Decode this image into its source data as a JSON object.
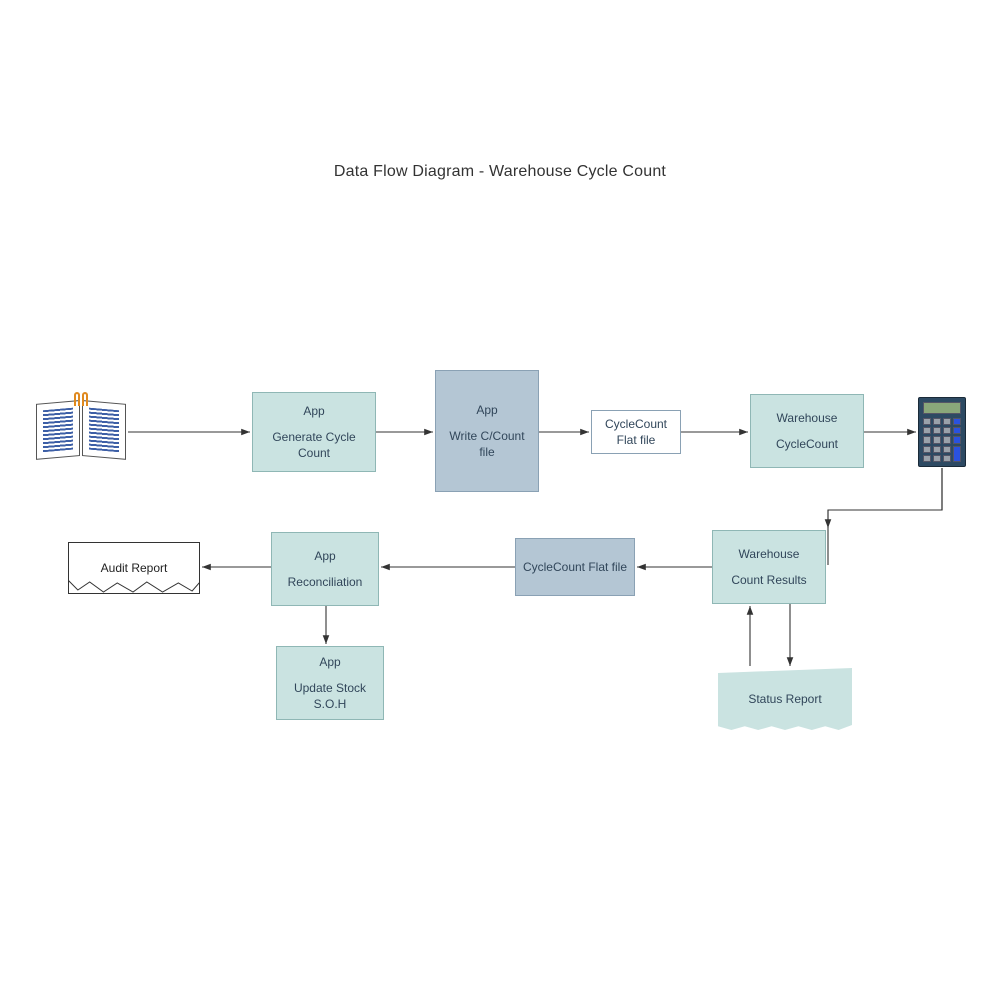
{
  "title": "Data Flow Diagram - Warehouse Cycle Count",
  "nodes": {
    "generateCycle": {
      "line1": "App",
      "line2": "Generate Cycle Count"
    },
    "writeCCount": {
      "line1": "App",
      "line2": "Write C/Count file"
    },
    "ccFlat1": {
      "line1": "CycleCount Flat file"
    },
    "whCycleCount": {
      "line1": "Warehouse",
      "line2": "CycleCount"
    },
    "whCountResults": {
      "line1": "Warehouse",
      "line2": "Count Results"
    },
    "ccFlat2": {
      "line1": "CycleCount Flat file"
    },
    "reconciliation": {
      "line1": "App",
      "line2": "Reconciliation"
    },
    "updateStock": {
      "line1": "App",
      "line2": "Update Stock S.O.H"
    },
    "auditReport": {
      "label": "Audit Report"
    },
    "statusReport": {
      "label": "Status Report"
    }
  },
  "icons": {
    "left": "book-icon",
    "right": "calculator-icon"
  }
}
